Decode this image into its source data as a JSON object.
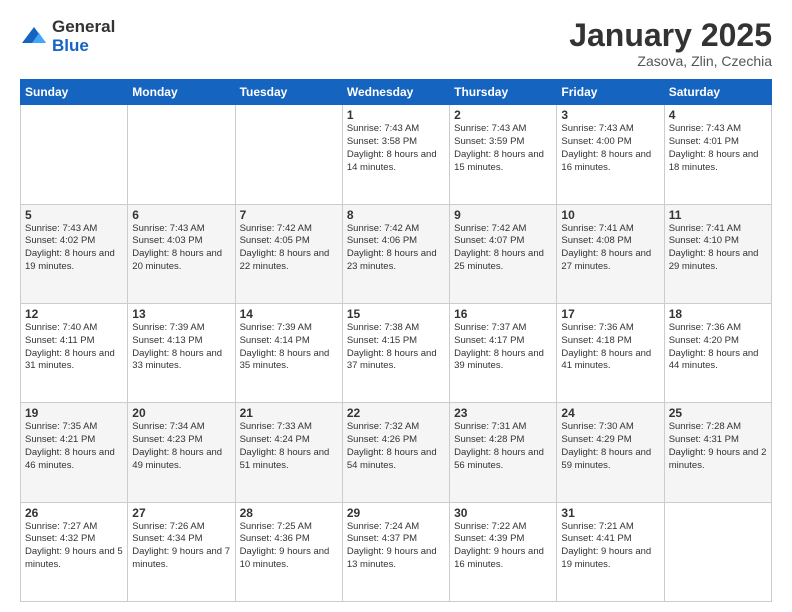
{
  "logo": {
    "general": "General",
    "blue": "Blue"
  },
  "title": "January 2025",
  "subtitle": "Zasova, Zlin, Czechia",
  "weekdays": [
    "Sunday",
    "Monday",
    "Tuesday",
    "Wednesday",
    "Thursday",
    "Friday",
    "Saturday"
  ],
  "weeks": [
    [
      {
        "day": "",
        "info": ""
      },
      {
        "day": "",
        "info": ""
      },
      {
        "day": "",
        "info": ""
      },
      {
        "day": "1",
        "info": "Sunrise: 7:43 AM\nSunset: 3:58 PM\nDaylight: 8 hours\nand 14 minutes."
      },
      {
        "day": "2",
        "info": "Sunrise: 7:43 AM\nSunset: 3:59 PM\nDaylight: 8 hours\nand 15 minutes."
      },
      {
        "day": "3",
        "info": "Sunrise: 7:43 AM\nSunset: 4:00 PM\nDaylight: 8 hours\nand 16 minutes."
      },
      {
        "day": "4",
        "info": "Sunrise: 7:43 AM\nSunset: 4:01 PM\nDaylight: 8 hours\nand 18 minutes."
      }
    ],
    [
      {
        "day": "5",
        "info": "Sunrise: 7:43 AM\nSunset: 4:02 PM\nDaylight: 8 hours\nand 19 minutes."
      },
      {
        "day": "6",
        "info": "Sunrise: 7:43 AM\nSunset: 4:03 PM\nDaylight: 8 hours\nand 20 minutes."
      },
      {
        "day": "7",
        "info": "Sunrise: 7:42 AM\nSunset: 4:05 PM\nDaylight: 8 hours\nand 22 minutes."
      },
      {
        "day": "8",
        "info": "Sunrise: 7:42 AM\nSunset: 4:06 PM\nDaylight: 8 hours\nand 23 minutes."
      },
      {
        "day": "9",
        "info": "Sunrise: 7:42 AM\nSunset: 4:07 PM\nDaylight: 8 hours\nand 25 minutes."
      },
      {
        "day": "10",
        "info": "Sunrise: 7:41 AM\nSunset: 4:08 PM\nDaylight: 8 hours\nand 27 minutes."
      },
      {
        "day": "11",
        "info": "Sunrise: 7:41 AM\nSunset: 4:10 PM\nDaylight: 8 hours\nand 29 minutes."
      }
    ],
    [
      {
        "day": "12",
        "info": "Sunrise: 7:40 AM\nSunset: 4:11 PM\nDaylight: 8 hours\nand 31 minutes."
      },
      {
        "day": "13",
        "info": "Sunrise: 7:39 AM\nSunset: 4:13 PM\nDaylight: 8 hours\nand 33 minutes."
      },
      {
        "day": "14",
        "info": "Sunrise: 7:39 AM\nSunset: 4:14 PM\nDaylight: 8 hours\nand 35 minutes."
      },
      {
        "day": "15",
        "info": "Sunrise: 7:38 AM\nSunset: 4:15 PM\nDaylight: 8 hours\nand 37 minutes."
      },
      {
        "day": "16",
        "info": "Sunrise: 7:37 AM\nSunset: 4:17 PM\nDaylight: 8 hours\nand 39 minutes."
      },
      {
        "day": "17",
        "info": "Sunrise: 7:36 AM\nSunset: 4:18 PM\nDaylight: 8 hours\nand 41 minutes."
      },
      {
        "day": "18",
        "info": "Sunrise: 7:36 AM\nSunset: 4:20 PM\nDaylight: 8 hours\nand 44 minutes."
      }
    ],
    [
      {
        "day": "19",
        "info": "Sunrise: 7:35 AM\nSunset: 4:21 PM\nDaylight: 8 hours\nand 46 minutes."
      },
      {
        "day": "20",
        "info": "Sunrise: 7:34 AM\nSunset: 4:23 PM\nDaylight: 8 hours\nand 49 minutes."
      },
      {
        "day": "21",
        "info": "Sunrise: 7:33 AM\nSunset: 4:24 PM\nDaylight: 8 hours\nand 51 minutes."
      },
      {
        "day": "22",
        "info": "Sunrise: 7:32 AM\nSunset: 4:26 PM\nDaylight: 8 hours\nand 54 minutes."
      },
      {
        "day": "23",
        "info": "Sunrise: 7:31 AM\nSunset: 4:28 PM\nDaylight: 8 hours\nand 56 minutes."
      },
      {
        "day": "24",
        "info": "Sunrise: 7:30 AM\nSunset: 4:29 PM\nDaylight: 8 hours\nand 59 minutes."
      },
      {
        "day": "25",
        "info": "Sunrise: 7:28 AM\nSunset: 4:31 PM\nDaylight: 9 hours\nand 2 minutes."
      }
    ],
    [
      {
        "day": "26",
        "info": "Sunrise: 7:27 AM\nSunset: 4:32 PM\nDaylight: 9 hours\nand 5 minutes."
      },
      {
        "day": "27",
        "info": "Sunrise: 7:26 AM\nSunset: 4:34 PM\nDaylight: 9 hours\nand 7 minutes."
      },
      {
        "day": "28",
        "info": "Sunrise: 7:25 AM\nSunset: 4:36 PM\nDaylight: 9 hours\nand 10 minutes."
      },
      {
        "day": "29",
        "info": "Sunrise: 7:24 AM\nSunset: 4:37 PM\nDaylight: 9 hours\nand 13 minutes."
      },
      {
        "day": "30",
        "info": "Sunrise: 7:22 AM\nSunset: 4:39 PM\nDaylight: 9 hours\nand 16 minutes."
      },
      {
        "day": "31",
        "info": "Sunrise: 7:21 AM\nSunset: 4:41 PM\nDaylight: 9 hours\nand 19 minutes."
      },
      {
        "day": "",
        "info": ""
      }
    ]
  ]
}
